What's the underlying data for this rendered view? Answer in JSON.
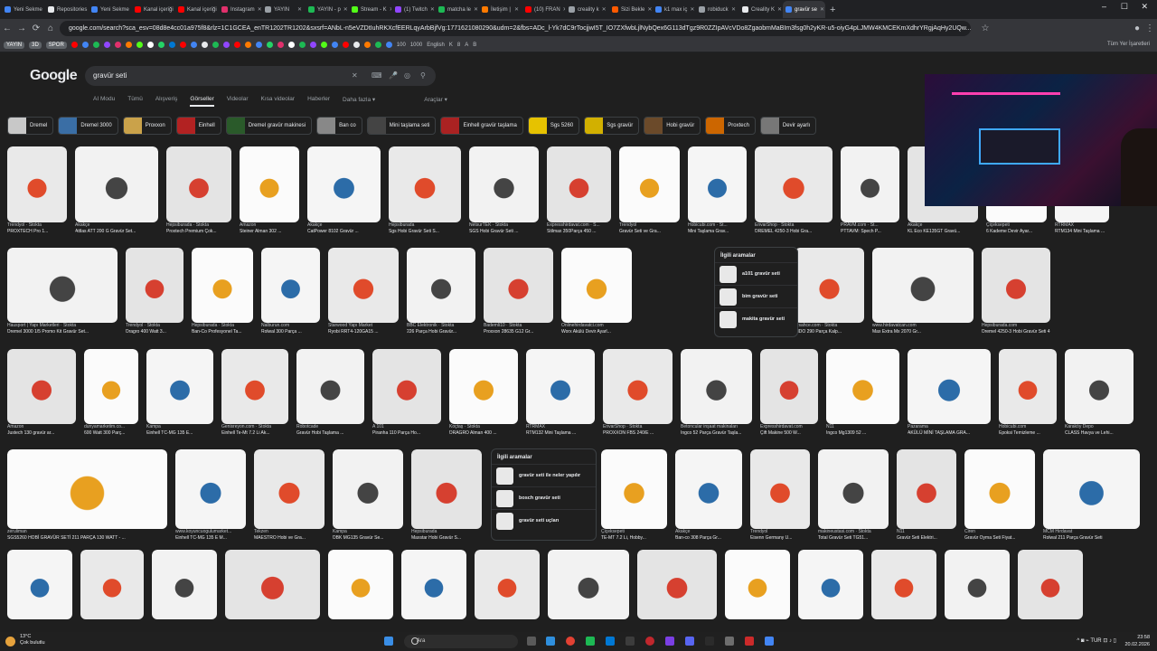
{
  "browser": {
    "tabs": [
      {
        "label": "Yeni Sekme",
        "color": "#4285f4"
      },
      {
        "label": "Repositories",
        "color": "#e8eaed"
      },
      {
        "label": "Yeni Sekme",
        "color": "#4285f4"
      },
      {
        "label": "Kanal içeriği",
        "color": "#ff0000"
      },
      {
        "label": "Kanal içeriği",
        "color": "#ff0000"
      },
      {
        "label": "Instagram",
        "color": "#e1306c"
      },
      {
        "label": "YAYIN",
        "color": "#9aa0a6"
      },
      {
        "label": "YAYIN - p",
        "color": "#1db954"
      },
      {
        "label": "Stream - K",
        "color": "#53fc18"
      },
      {
        "label": "(1) Twitch",
        "color": "#9146ff"
      },
      {
        "label": "matcha le",
        "color": "#1db954"
      },
      {
        "label": "İletişim |",
        "color": "#ff7a00"
      },
      {
        "label": "(10) FRAN",
        "color": "#ff0000"
      },
      {
        "label": "creality k",
        "color": "#9aa0a6"
      },
      {
        "label": "Sizi Bekle",
        "color": "#ff5a00"
      },
      {
        "label": "k1 max iç",
        "color": "#4285f4"
      },
      {
        "label": "robiduck",
        "color": "#9aa0a6"
      },
      {
        "label": "Creality K",
        "color": "#e8eaed"
      },
      {
        "label": "gravür se",
        "color": "#4285f4",
        "active": true
      }
    ],
    "url": "google.com/search?sca_esv=08d8e4cc01a975f8&rlz=1C1GCEA_enTR1202TR1202&sxsrf=ANbL-n5eVZDtIuhRKXcfEERLqyArbBjfVg:1771621080290&udm=2&fbs=ADc_l-Yk7dC9rTocjjwI5T_IO7ZXfwbLjlNybQex6G113dTgz9R0ZZIpAVcVDo8ZgaobmMaBIm3fsg0h2yKR-u5-oiyG4pLJMW4KMCEKmXdhrYRgjAqHy2UQw...",
    "bookmark_tags": [
      "YAYIN",
      "3D",
      "SPOR"
    ],
    "bookmark_texts": [
      "100",
      "1000",
      "English",
      "K",
      "8",
      "A",
      "B"
    ],
    "all_bookmarks": "Tüm Yer İşaretleri"
  },
  "google": {
    "logo": "Google",
    "query": "gravür seti",
    "tabs": [
      "AI Modu",
      "Tümü",
      "Alışveriş",
      "Görseller",
      "Videolar",
      "Kısa videolar",
      "Haberler",
      "Daha fazla ▾",
      "Araçlar ▾"
    ],
    "active_tab": "Görseller",
    "chips": [
      "Dremel",
      "Dremel 3000",
      "Proxxon",
      "Einhell",
      "Dremel gravür makinesi",
      "Ban co",
      "Mini taşlama seti",
      "Einhell gravür taşlama",
      "Sgs 5260",
      "Sgs gravür",
      "Hobi gravür",
      "Proxtech",
      "Devir ayarlı"
    ],
    "chip_colors": [
      "#c8c8c8",
      "#3a6ea5",
      "#caa24a",
      "#b22222",
      "#2a5a2a",
      "#888888",
      "#444444",
      "#aa2222",
      "#e6c200",
      "#d2b000",
      "#6b4a2a",
      "#cc6600",
      "#777777"
    ],
    "rows": [
      [
        {
          "source": "Trendyol · Stokta",
          "title": "PROXTECH Pro 1..."
        },
        {
          "source": "Akakçe",
          "title": "Attlas ATT 200 G Gravür Set..."
        },
        {
          "source": "Hepsiburada · Stokta",
          "title": "Proxtech Premium Çok..."
        },
        {
          "source": "Amazon",
          "title": "Steiner Alman 302 ..."
        },
        {
          "source": "Akakçe",
          "title": "CatPower 8102 Gravür ..."
        },
        {
          "source": "Hepsiburada",
          "title": "Sgs Hobi Gravür Seti S..."
        },
        {
          "source": "NetsurTEK · Stokta",
          "title": "SGS Hobi Gravür Seti ..."
        },
        {
          "source": "Expresshirdavat.com · S...",
          "title": "Stilmax 350Parça 450 ..."
        },
        {
          "source": "Trendyol",
          "title": "Gravür Seti ve Gra..."
        },
        {
          "source": "Hobicubi.com · St...",
          "title": "Mini Taşlama Grav..."
        },
        {
          "source": "EnvarShop · Stokta",
          "title": "DREMEL 4250-3 Hobi Gra..."
        },
        {
          "source": "PRAVM.com · St...",
          "title": "PTTAVM: Spech P..."
        },
        {
          "source": "Akakçe",
          "title": "KL Eco KE135GT Gravü..."
        },
        {
          "source": "Çiçeksepeti",
          "title": "6 Kademe Devir Ayar..."
        },
        {
          "source": "RTRMAX",
          "title": "RTM134 Mini Taşlama ..."
        }
      ],
      [
        {
          "source": "Hausport | Yapı Marketleri · Stokta",
          "title": "Dremel 3000 1/5 Promo Kit Gravür Set..."
        },
        {
          "source": "Trendyol · Stokta",
          "title": "Dragro 400 Watt 3..."
        },
        {
          "source": "Hepsiburada · Stokta",
          "title": "Ban-Co Profesyonel Ta..."
        },
        {
          "source": "Nalburun.com",
          "title": "Rolwal 300 Parça ..."
        },
        {
          "source": "Starwood Yapı Market",
          "title": "Ryobi RRT4-120GA15 ..."
        },
        {
          "source": "BBC Elektronik · Stokta",
          "title": "226 Parça Hobi Gravür..."
        },
        {
          "source": "Bademli10 · Stokta",
          "title": "Proxxon 28635 G12 Gr..."
        },
        {
          "source": "Onlinehirdavatci.com",
          "title": "Worx Akülü Devir Ayarl..."
        },
        {
          "source": "Gizmalı Makine Kl...",
          "title": "Gravür Seti 234 Pa..."
        },
        {
          "source": "ersahce.com · Stokta",
          "title": "VIDO 290 Parça Kalp..."
        },
        {
          "source": "www.hirdavatcan.com",
          "title": "Max Extra Mx 2070 Gr..."
        },
        {
          "source": "Hepsiburada.com",
          "title": "Dremel 4250-3 Hobi Gravür Seti 45..."
        },
        {
          "source": "Hatton",
          "title": "Proskit Pt-5501i 40 P..."
        }
      ],
      [
        {
          "source": "Amazon",
          "title": "Justech 130 gravür ar..."
        },
        {
          "source": "dunyamarketim.co...",
          "title": "600 Watt 300 Parç..."
        },
        {
          "source": "Kampa",
          "title": "Einhell TC-MG 135 E..."
        },
        {
          "source": "Genisreyon.com · Stokta",
          "title": "Einhell Te-Mt 7.2 Li Ak..."
        },
        {
          "source": "Robotcade",
          "title": "Gravür Hobi Taşlama ..."
        },
        {
          "source": "A 101",
          "title": "Piranha 110 Parça Ho..."
        },
        {
          "source": "Koçtaş · Stokta",
          "title": "DRAGRO Alman 400 ..."
        },
        {
          "source": "RTRMAX",
          "title": "RTM132 Mini Taşlama ..."
        },
        {
          "source": "EnvarShop · Stokta",
          "title": "PROXXON FBS 240/E ..."
        },
        {
          "source": "Betoncular inşaat makinaları",
          "title": "Ingco 52 Parça Gravür Taşla..."
        },
        {
          "source": "Expresshirdavat.com",
          "title": "Çift Makine 500 W..."
        },
        {
          "source": "N11",
          "title": "Ingco Mg1309 52 ..."
        },
        {
          "source": "Pazarama",
          "title": "AKÜLÜ MİNİ TAŞLAMA GRA..."
        },
        {
          "source": "Hobicubi.com",
          "title": "Epoksi Temizleme ..."
        },
        {
          "source": "Karaköy Depo",
          "title": "CLASS Havya ve Lehi..."
        }
      ],
      [
        {
          "source": "zeruliman",
          "title": "SGS5260 HOBİ GRAVÜR SETİ 211 PARÇA 130 WATT - ..."
        },
        {
          "source": "www.koyuncuogulumarket...",
          "title": "Einhell TC-MG 135 E M..."
        },
        {
          "source": "Tekzen",
          "title": "MAESTRO Hobi ve Gra..."
        },
        {
          "source": "Kampa",
          "title": "DBK MG135 Gravür Se..."
        },
        {
          "source": "Hepsiburada",
          "title": "Maxstar Hobi Gravür S..."
        },
        {
          "source": "Çiçeksepeti",
          "title": "TE-MT 7.2 Li, Hobby..."
        },
        {
          "source": "Akakçe",
          "title": "Ban-co 308 Parça Gr..."
        },
        {
          "source": "Trendyol",
          "title": "Eisenn Germany U..."
        },
        {
          "source": "makineustasi.com · Stokta",
          "title": "Total Gravür Seti TG51..."
        },
        {
          "source": "N11",
          "title": "Gravür Seti Elektri..."
        },
        {
          "source": "Ciren",
          "title": "Gravür Oyma Seti Fiyat..."
        },
        {
          "source": "MCM Hırdavat",
          "title": "Rolwal 211 Parça Gravür Seti"
        }
      ],
      [
        {
          "source": "",
          "title": ""
        },
        {
          "source": "",
          "title": ""
        },
        {
          "source": "",
          "title": ""
        },
        {
          "source": "",
          "title": ""
        },
        {
          "source": "",
          "title": ""
        },
        {
          "source": "",
          "title": ""
        },
        {
          "source": "",
          "title": ""
        },
        {
          "source": "",
          "title": ""
        },
        {
          "source": "",
          "title": ""
        },
        {
          "source": "",
          "title": ""
        },
        {
          "source": "",
          "title": ""
        },
        {
          "source": "",
          "title": ""
        },
        {
          "source": "",
          "title": ""
        },
        {
          "source": "",
          "title": ""
        }
      ]
    ],
    "related1": {
      "heading": "İlgili aramalar",
      "items": [
        "a101 gravür seti",
        "bim gravür seti",
        "makita gravür seti"
      ]
    },
    "related2": {
      "heading": "İlgili aramalar",
      "items": [
        "gravür seti ile neler yapılır",
        "bosch gravür seti",
        "gravür seti uçları"
      ]
    }
  },
  "taskbar": {
    "weather_temp": "13°C",
    "weather_desc": "Çok bulutlu",
    "search_placeholder": "Ara",
    "time": "23:58",
    "date": "20.02.2026",
    "tray_lang": "TUR"
  }
}
